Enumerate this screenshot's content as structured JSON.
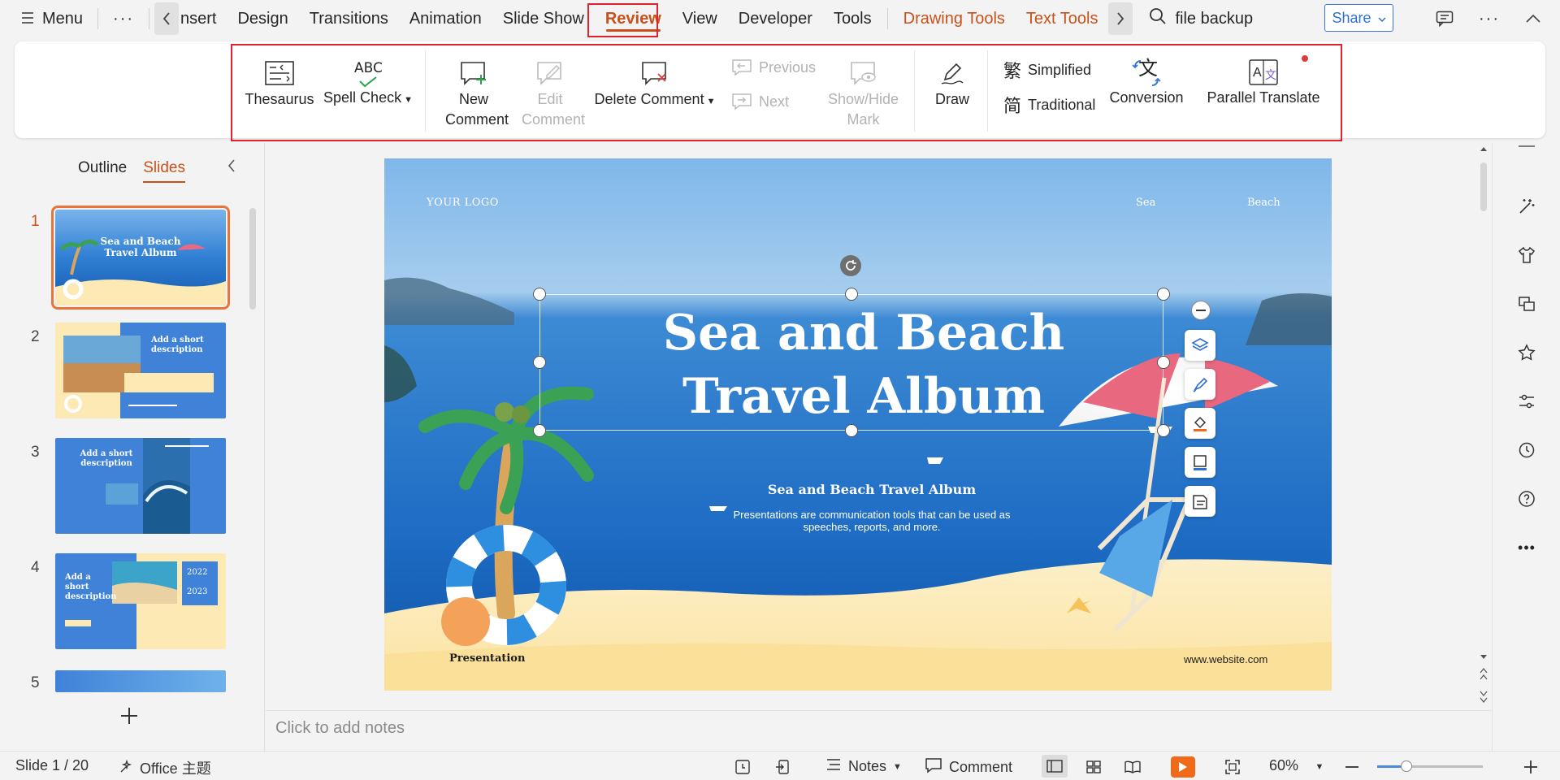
{
  "menubar": {
    "menu_label": "Menu",
    "more": "···",
    "tabs": [
      "Insert",
      "Design",
      "Transitions",
      "Animation",
      "Slide Show",
      "Review",
      "View",
      "Developer",
      "Tools",
      "Drawing Tools",
      "Text Tools"
    ],
    "tab_clipped_text": "nsert",
    "active_tab": "Review",
    "search_text": "file backup",
    "share_label": "Share"
  },
  "ribbon": {
    "thesaurus": "Thesaurus",
    "spell_check": "Spell Check",
    "spell_check_icon_text": "ABC",
    "new_comment": "New Comment",
    "edit_comment": "Edit Comment",
    "delete_comment": "Delete Comment",
    "previous": "Previous",
    "next": "Next",
    "show_hide_mark": "Show/Hide Mark",
    "draw": "Draw",
    "simplified": "Simplified",
    "simplified_glyph": "繁",
    "traditional": "Traditional",
    "traditional_glyph": "简",
    "conversion": "Conversion",
    "conversion_glyph": "文",
    "parallel_translate": "Parallel Translate",
    "parallel_translate_glyph": "A",
    "parallel_translate_glyph2": "文"
  },
  "left_panel": {
    "outline_tab": "Outline",
    "slides_tab": "Slides",
    "slide_numbers": [
      "1",
      "2",
      "3",
      "4",
      "5"
    ],
    "thumbs": {
      "t1_title": "Sea and Beach Travel Album",
      "t2_title": "Add a short description",
      "t3_title": "Add a short description",
      "t4_title": "Add a short description",
      "t4_year1": "2022",
      "t4_year2": "2023"
    }
  },
  "slide": {
    "logo": "YOUR LOGO",
    "nav1": "Sea",
    "nav2": "Beach",
    "title_line1": "Sea and Beach",
    "title_line2": "Travel Album",
    "subtitle": "Sea and Beach Travel Album",
    "desc_line1": "Presentations are communication tools that can be used as",
    "desc_line2": "speeches, reports, and more.",
    "footer_left": "Presentation",
    "footer_right": "www.website.com"
  },
  "notes_placeholder": "Click to add notes",
  "status": {
    "slide_info": "Slide 1 / 20",
    "theme": "Office 主题",
    "notes": "Notes",
    "comment": "Comment",
    "zoom": "60%",
    "zoom_level_percent": 28
  }
}
